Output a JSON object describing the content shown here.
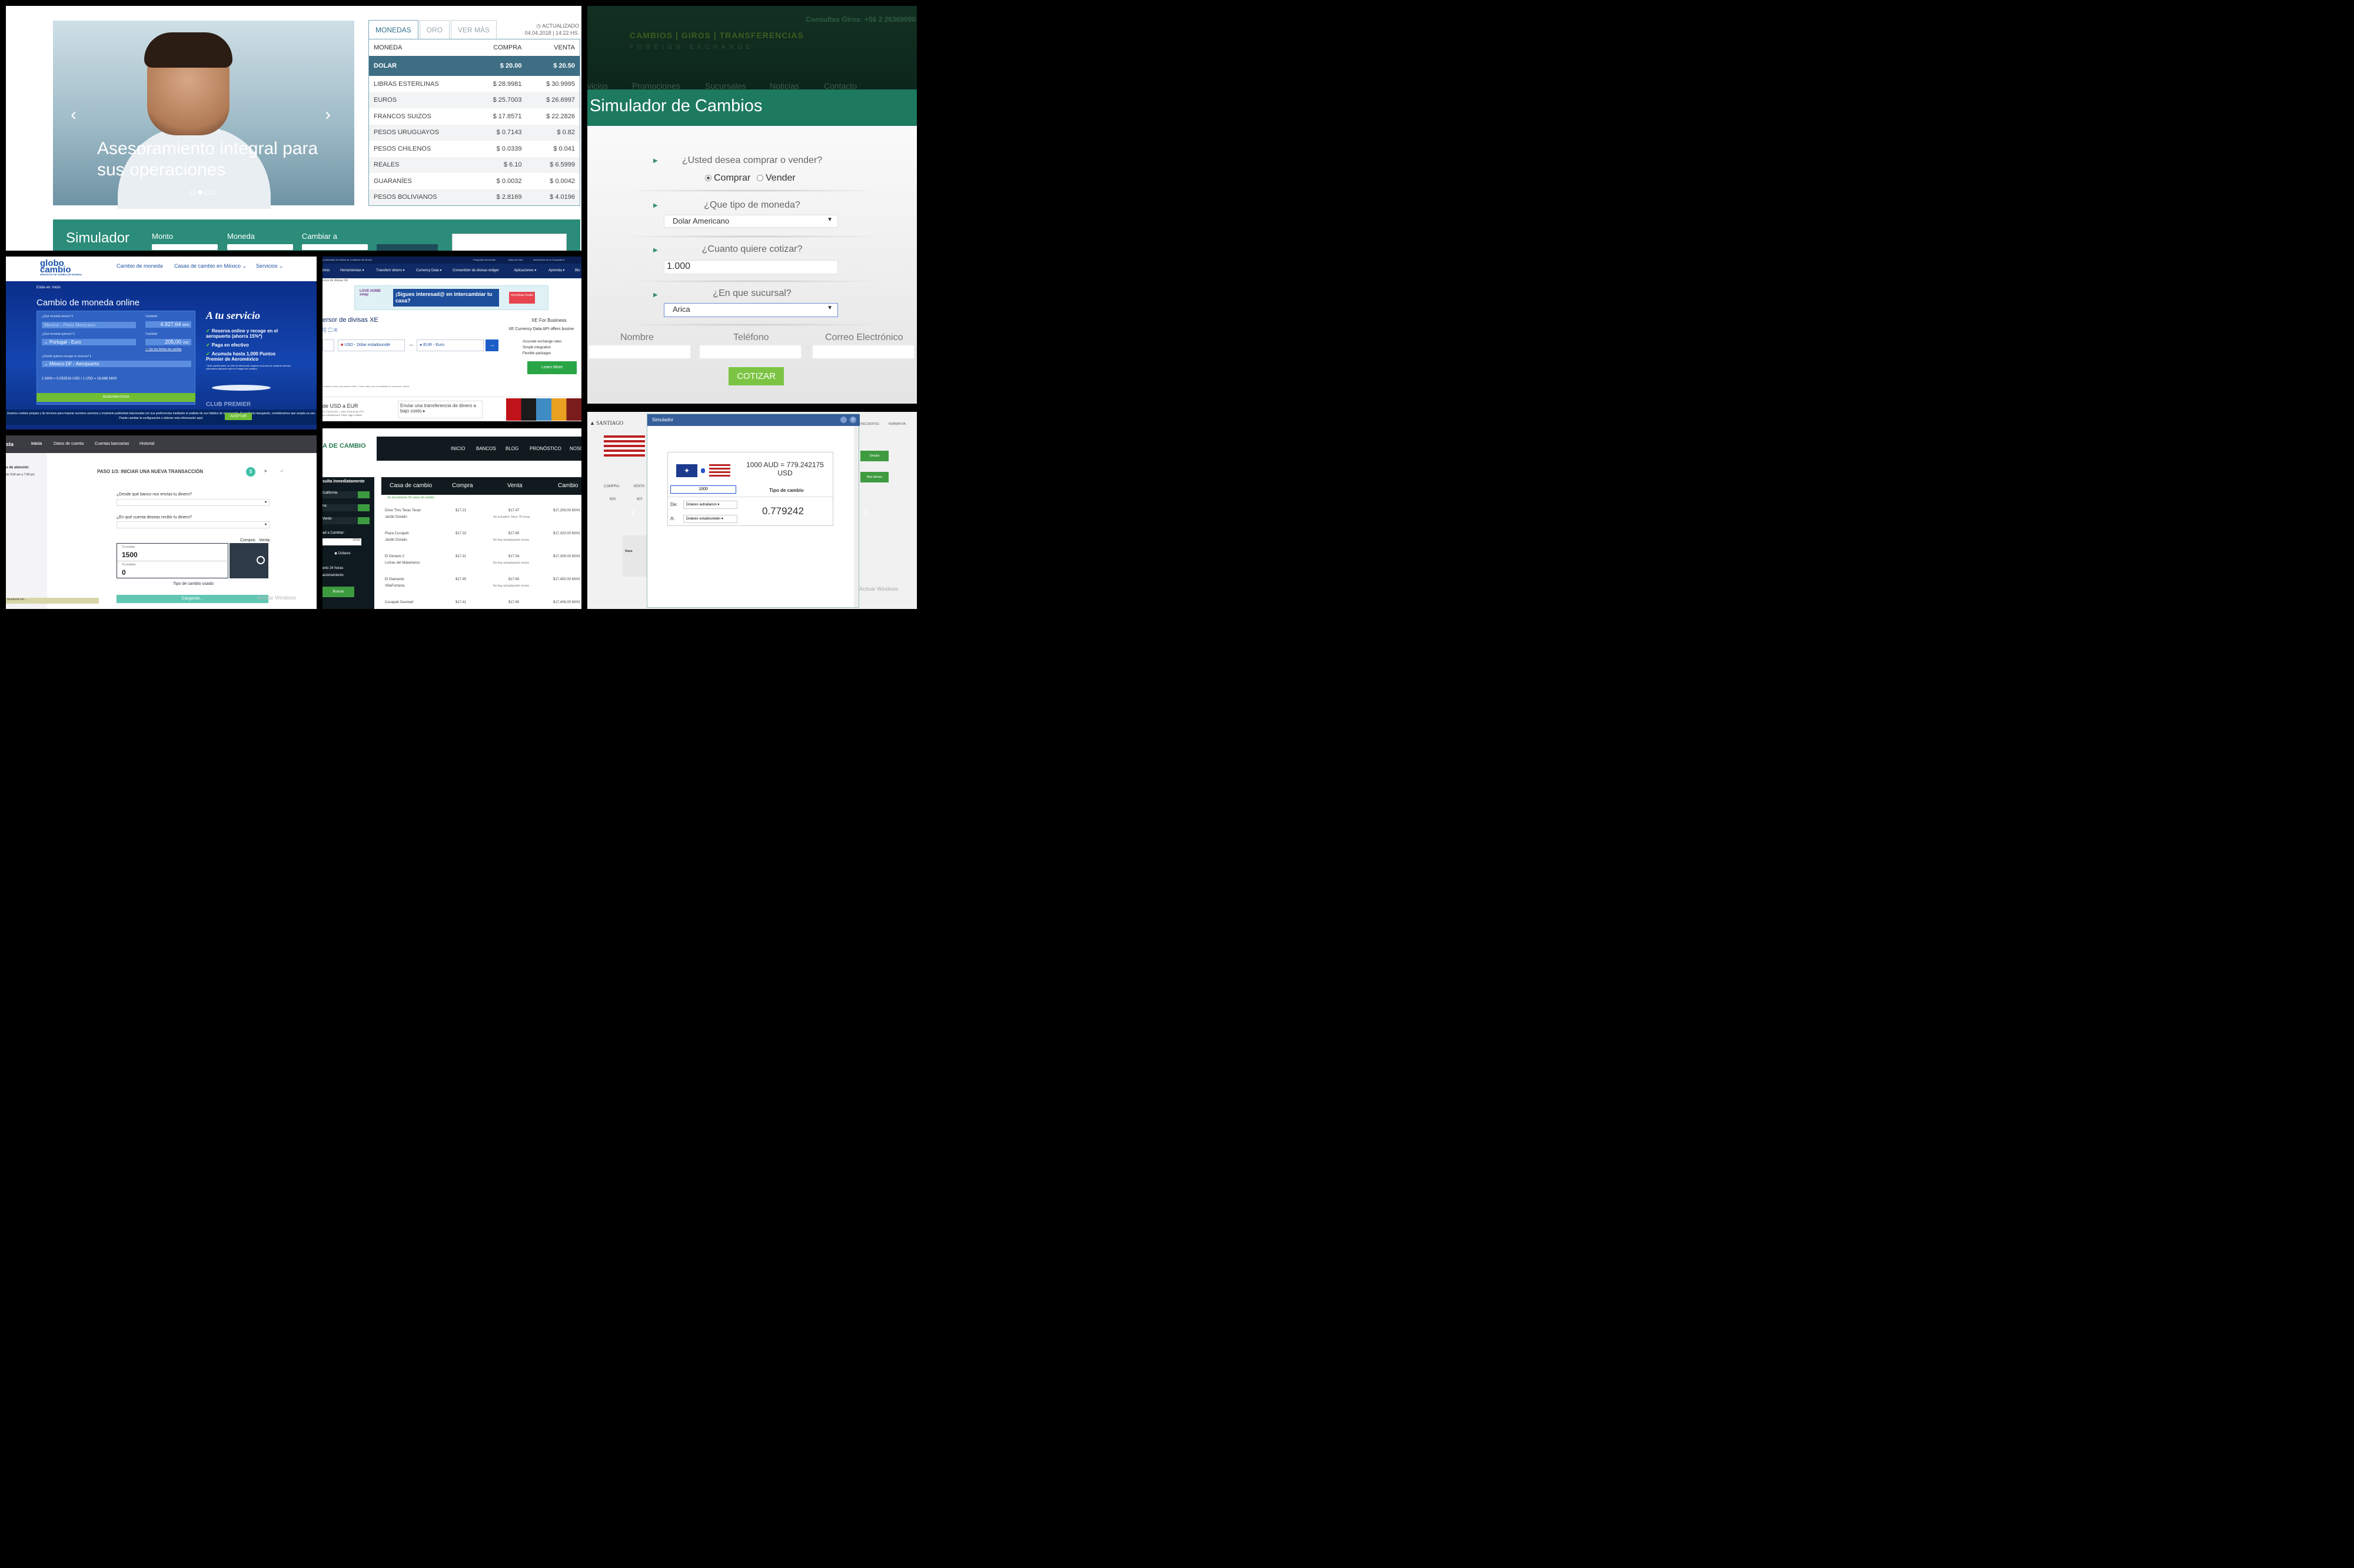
{
  "p1": {
    "hero_caption": "Asesoramiento integral para sus operaciones",
    "prev": "‹",
    "next": "›",
    "tabs": [
      "MONEDAS",
      "ORO",
      "VER MÁS"
    ],
    "updated_label": "ACTUALIZADO",
    "updated_time": "04.04.2018 | 14:22 HS.",
    "headers": [
      "MONEDA",
      "COMPRA",
      "VENTA"
    ],
    "rows": [
      [
        "DOLAR",
        "$ 20.00",
        "$ 20.50"
      ],
      [
        "LIBRAS ESTERLINAS",
        "$ 28.9981",
        "$ 30.9995"
      ],
      [
        "EUROS",
        "$ 25.7003",
        "$ 26.6997"
      ],
      [
        "FRANCOS SUIZOS",
        "$ 17.8571",
        "$ 22.2826"
      ],
      [
        "PESOS URUGUAYOS",
        "$ 0.7143",
        "$ 0.82"
      ],
      [
        "PESOS CHILENOS",
        "$ 0.0339",
        "$ 0.041"
      ],
      [
        "REALES",
        "$ 6.10",
        "$ 6.5999"
      ],
      [
        "GUARANÍES",
        "$ 0.0032",
        "$ 0.0042"
      ],
      [
        "PESOS BOLIVIANOS",
        "$ 2.8169",
        "$ 4.0196"
      ]
    ],
    "sim_title": "Simulador",
    "sim_monto": "Monto",
    "sim_moneda": "Moneda",
    "sim_cambiar": "Cambiar a",
    "sim_btn": "SIMULAR"
  },
  "p2": {
    "consultas": "Consultas Giros: +56 2 26369090",
    "logo": "CAMBIOS | GIROS | TRANSFERENCIAS",
    "fx": "FOREIGN EXCHANGE",
    "nav": [
      "vicios",
      "Promociones",
      "Sucursales",
      "Noticias",
      "Contacto"
    ],
    "title": "Simulador de Cambios",
    "q1": "¿Usted desea comprar o vender?",
    "comprar": "Comprar",
    "vender": "Vender",
    "q2": "¿Que tipo de moneda?",
    "moneda": "Dolar Americano",
    "q3": "¿Cuanto quiere cotizar?",
    "monto": "1.000",
    "q4": "¿En que sucursal?",
    "sucursal": "Arica",
    "f_nombre": "Nombre",
    "f_tel": "Teléfono",
    "f_correo": "Correo Electrónico",
    "btn": "COTIZAR"
  },
  "p3": {
    "logo1": "globo",
    "logo2": "cambio",
    "logo_sub": "SERVICIOS DE CAMBIO DE MONEDA",
    "nav": [
      "Cambio de moneda",
      "Casas de cambio en México ⌄",
      "Servicios ⌄"
    ],
    "crumb": "Estás en:   Inicio",
    "title": "Cambio de moneda online",
    "lab_tienes": "¿Qué moneda tienes? ℹ",
    "tienes": "Mexico - Peso Mexicano",
    "lab_cant": "Cantidad",
    "cant1": "4.927,64",
    "mxn": "MXN",
    "lab_quieres": "¿Qué moneda quieres? ℹ",
    "quieres": "⌄ Portugal - Euro",
    "cant2": "205,00",
    "usd": "USD",
    "limites": "Ver los límites de cambio",
    "lab_donde": "¿Dónde quieres recoger tu reserva? ℹ",
    "donde": "⌄ México DF - Aeropuerto",
    "rate": "1 MXN = 0,053516 USD / 1 USD = 18,686 MXN",
    "reservar": "RESERVAR DIVISA",
    "servicio": "A tu servicio",
    "li1": "Reserva online y recoge en el aeropuerto (ahorra 15%*)",
    "li2": "Paga en efectivo",
    "li3": "Acumula hasta 1,000 Puntos Premier de Aeroméxico",
    "note": "* Este cambio tiene un 15% de descuento respecto al precio de nuestras oficinas (descuento aplicado sobre el margen de cambio).",
    "club": "CLUB PREMIER",
    "cookie": "Usamos cookies propias y de terceros para mejorar nuestros servicios y mostrarle publicidad relacionada con sus preferencias mediante el análisis de sus hábitos de navegación. Si continúa navegando, consideramos que acepta su uso. Puede cambiar la configuración u obtener más información aquí.",
    "aceptar": "ACEPTAR"
  },
  "p4": {
    "topbar": "a Autoridad de Divisas de Confianza del Mundo",
    "toplinks": [
      "Preguntas frecuentes",
      "Mapa del sitio",
      "Información de la Compañía ▾"
    ],
    "nav": [
      "nicio",
      "Herramientas ▾",
      "Transferir dinero ▾",
      "Currency Data ▾",
      "Convertidor de divisas widget",
      "Aplicaciones ▾",
      "Aprenda ▾",
      "Blo"
    ],
    "crumb": "ersor de divisas XE",
    "ad_love": "LOVE HOME swap",
    "ad_text": "¡Sigues interesad@ en intercambiar tu casa?",
    "ad_btn": "Inscríbase Gratis",
    "title": "ersor de divisas XE",
    "biz": "XE For Business",
    "biz2": "XE Currency Data API offers busine",
    "from": "USD - Dólar estadounide",
    "to": "EUR - Euro",
    "feat1": "Accurate exchange rates",
    "feat2": "Simple integration",
    "feat3": "Flexible packages",
    "learn": "Learn More",
    "disc": "e based on live mid-market rates. These rates are not available to consumer clients.",
    "b1": "de USD a EUR",
    "b1s": "017 00:00 UTC - 4 Abr 2018 00:30 UTC",
    "b1r": "se 0.81468 low 0.79937 high 0.94505",
    "b2": "Enviar una transferencia de dinero a bajo costo ▸"
  },
  "p5": {
    "brand": "sta",
    "nav": [
      "Inicio",
      "Datos de cuenta",
      "Cuentas bancarias",
      "Historial"
    ],
    "side1": "o de atención",
    "side2": "de 9:00 am a 7:00 pm",
    "step": "PASO 1/3: INICIAR UNA NUEVA TRANSACCIÓN",
    "q1": "¿Desde qué banco nos envías tu dinero?",
    "q2": "¿En qué cuenta deseas recibir tu dinero?",
    "compra": "Compra:",
    "venta": "Venta:",
    "envias": "Tú envías",
    "envias_v": "1500",
    "recibes": "Tú recibes",
    "recibes_v": "0",
    "tipo": "Tipo de cambio usado:",
    "loading": "Cargando...",
    "fb": "facebook.net...",
    "wm": "Activar Windows"
  },
  "p6": {
    "logo": "A DE CAMBIO",
    "nav": [
      "INICIO",
      "BANCOS",
      "BLOG",
      "PRONÓSTICO",
      "NOSO"
    ],
    "left_title": "sulta inmediatamente",
    "left_items": [
      "California",
      "na",
      "Verde"
    ],
    "left_cambiar": "ad a Cambiar:",
    "left_usd": "USD",
    "left_dol": "Dólares",
    "left_note": "erto 24 horas",
    "left_note2": "acionamiento",
    "buscar": "Buscar",
    "headers": [
      "Casa de cambio",
      "Compra",
      "Venta",
      "Cambio"
    ],
    "found": "Se encontraron 20 casas de cambio",
    "rows": [
      [
        "Drive Thru Teran Teran",
        "Jardin Dorado",
        "$17.21",
        "$17.47",
        "$17,209.00 MXN",
        "Se actualizó: Hace 76 horas"
      ],
      [
        "Plaza Cucapah",
        "Jardin Dorado",
        "$17.32",
        "$17.65",
        "$17,320.00 MXN",
        "No hay actualización recien"
      ],
      [
        "El Denario 2",
        "Lomas del Matamoros",
        "$17.31",
        "$17.54",
        "$17,309.00 MXN",
        "No hay actualización recien"
      ],
      [
        "El Diamante",
        "VillaFontana",
        "$17.45",
        "$17.60",
        "$17,450.00 MXN",
        "No hay actualización recien"
      ],
      [
        "Cucapah Gasmart",
        "",
        "$17.41",
        "$17.65",
        "$17,406.00 MXN",
        ""
      ]
    ]
  },
  "p7": {
    "brand": "SANTIAGO",
    "modal_title": "Simulador",
    "result": "1000 AUD = 779.242175 USD",
    "amount": "1000",
    "tipo": "Tipo de cambio",
    "de": "De:",
    "a": "A:",
    "from": "Dolares autralianos",
    "to": "Dolares estadouniden",
    "rate": "0.779242",
    "bg_compra": "COMPRA",
    "bg_venta": "VENTA",
    "bg_v1": "600",
    "bg_v2": "607",
    "bg_frec": "FRECUENTES",
    "bg_norm": "NORMATIVA",
    "btn_sim": "Simular",
    "btn_mas": "Mas divisas",
    "mapa": "Mapa",
    "wm": "Activar Windows"
  }
}
